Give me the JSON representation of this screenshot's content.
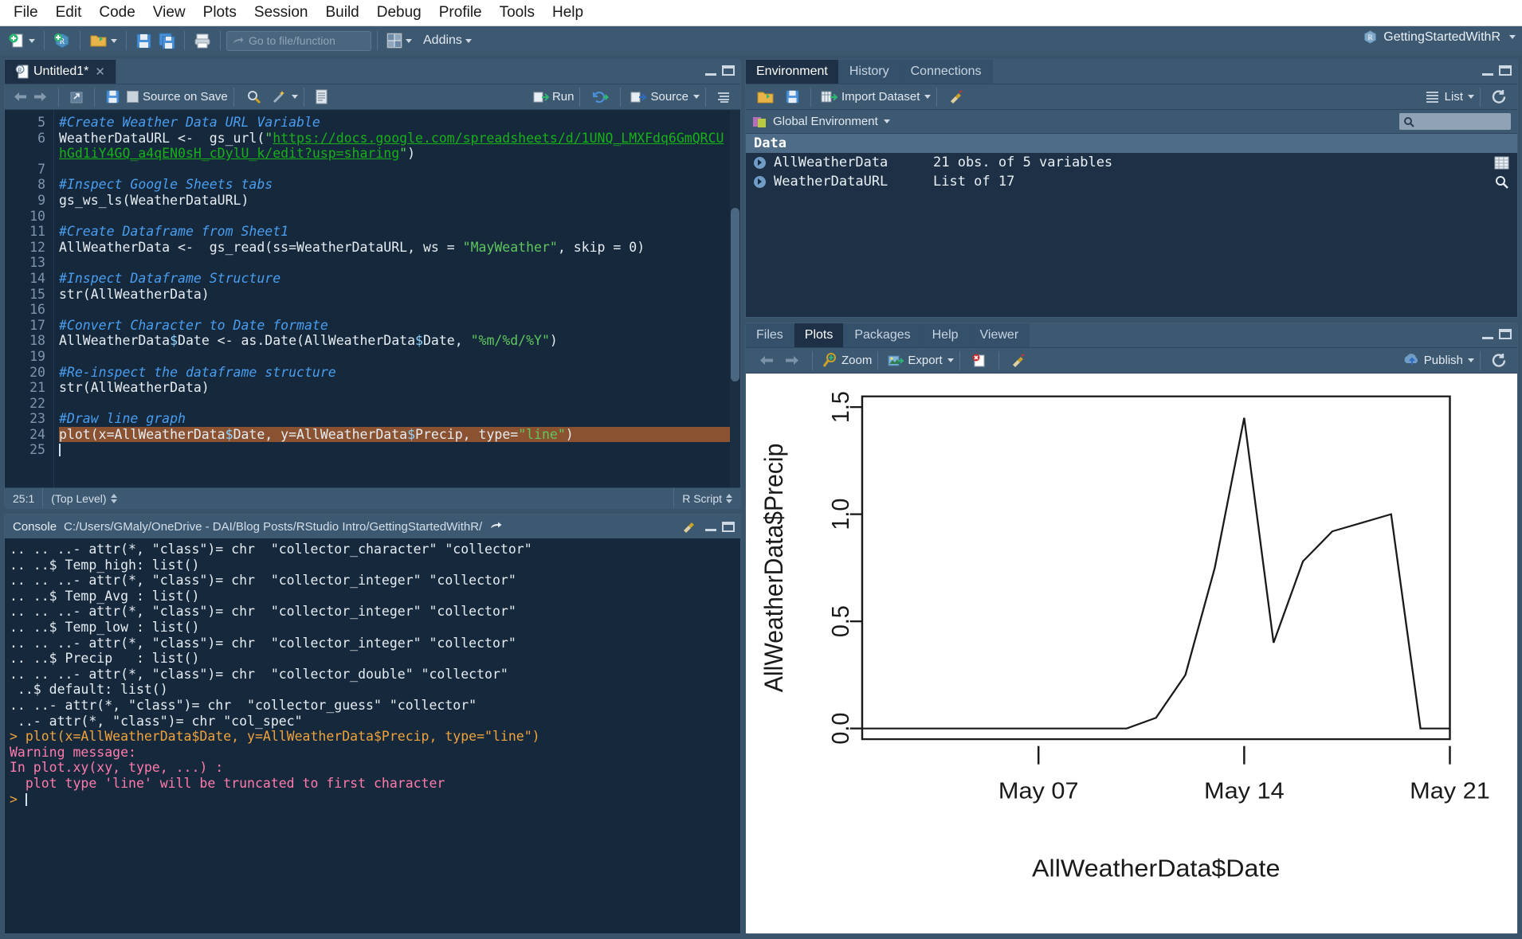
{
  "menubar": {
    "items": [
      "File",
      "Edit",
      "Code",
      "View",
      "Plots",
      "Session",
      "Build",
      "Debug",
      "Profile",
      "Tools",
      "Help"
    ]
  },
  "toolbar": {
    "goto_placeholder": "Go to file/function",
    "addins_label": "Addins",
    "project_name": "GettingStartedWithR",
    "icons": [
      "new-file-icon",
      "new-project-icon",
      "open-file-icon",
      "save-icon",
      "save-all-icon",
      "print-icon",
      "forward-arrow-icon",
      "panes-icon"
    ]
  },
  "source_pane": {
    "tab_label": "Untitled1*",
    "toolbar": {
      "back_label": "back-arrow-icon",
      "forward_label": "forward-arrow-icon",
      "popout_label": "show-in-new-window-icon",
      "save_label": "save-icon",
      "source_on_save_label": "Source on Save",
      "find_label": "find-icon",
      "wand_label": "code-tools-icon",
      "compile_label": "compile-report-icon",
      "run_label": "Run",
      "rerun_label": "re-run-icon",
      "source_label": "Source",
      "outline_label": "outline-icon"
    },
    "lines": [
      {
        "n": "5",
        "html": "<span class='cmt'>#Create Weather Data URL Variable</span>"
      },
      {
        "n": "6",
        "html": "WeatherDataURL &lt;-  gs_url(<span class='str'>\"</span><span class='url'>https://docs.google.com/spreadsheets/d/1UNQ_LMXFdq6GmQRCU</span>"
      },
      {
        "n": "",
        "html": "<span class='url'>hGd1iY4GQ_a4qEN0sH_cDylU_k/edit?usp=sharing</span><span class='str'>\"</span>)"
      },
      {
        "n": "7",
        "html": ""
      },
      {
        "n": "8",
        "html": "<span class='cmt'>#Inspect Google Sheets tabs</span>"
      },
      {
        "n": "9",
        "html": "gs_ws_ls(WeatherDataURL)"
      },
      {
        "n": "10",
        "html": ""
      },
      {
        "n": "11",
        "html": "<span class='cmt'>#Create Dataframe from Sheet1</span>"
      },
      {
        "n": "12",
        "html": "AllWeatherData &lt;-  gs_read(ss=WeatherDataURL, ws = <span class='str'>\"MayWeather\"</span>, skip = <span class='num'>0</span>)"
      },
      {
        "n": "13",
        "html": ""
      },
      {
        "n": "14",
        "html": "<span class='cmt'>#Inspect Dataframe Structure</span>"
      },
      {
        "n": "15",
        "html": "str(AllWeatherData)"
      },
      {
        "n": "16",
        "html": ""
      },
      {
        "n": "17",
        "html": "<span class='cmt'>#Convert Character to Date formate</span>"
      },
      {
        "n": "18",
        "html": "AllWeatherData<span class='dollar'>$</span>Date &lt;- as.Date(AllWeatherData<span class='dollar'>$</span>Date, <span class='str'>\"%m/%d/%Y\"</span>)"
      },
      {
        "n": "19",
        "html": ""
      },
      {
        "n": "20",
        "html": "<span class='cmt'>#Re-inspect the dataframe structure</span>"
      },
      {
        "n": "21",
        "html": "str(AllWeatherData)"
      },
      {
        "n": "22",
        "html": ""
      },
      {
        "n": "23",
        "html": "<span class='cmt'>#Draw line graph</span>"
      },
      {
        "n": "24",
        "html": "<span class='hl'>plot(x=AllWeatherData<span class='dollar'>$</span>Date, y=AllWeatherData<span class='dollar'>$</span>Precip, type=<span class='str'>\"line\"</span>)</span>"
      },
      {
        "n": "25",
        "html": "<span class='cursorbar'></span>"
      }
    ],
    "status": {
      "position": "25:1",
      "scope": "(Top Level)",
      "filetype": "R Script"
    }
  },
  "console_pane": {
    "title": "Console",
    "path": "C:/Users/GMaly/OneDrive - DAI/Blog Posts/RStudio Intro/GettingStartedWithR/",
    "lines": [
      {
        "cls": "c-out",
        "text": ".. .. ..- attr(*, \"class\")= chr  \"collector_character\" \"collector\""
      },
      {
        "cls": "c-out",
        "text": ".. ..$ Temp_high: list()"
      },
      {
        "cls": "c-out",
        "text": ".. .. ..- attr(*, \"class\")= chr  \"collector_integer\" \"collector\""
      },
      {
        "cls": "c-out",
        "text": ".. ..$ Temp_Avg : list()"
      },
      {
        "cls": "c-out",
        "text": ".. .. ..- attr(*, \"class\")= chr  \"collector_integer\" \"collector\""
      },
      {
        "cls": "c-out",
        "text": ".. ..$ Temp_low : list()"
      },
      {
        "cls": "c-out",
        "text": ".. .. ..- attr(*, \"class\")= chr  \"collector_integer\" \"collector\""
      },
      {
        "cls": "c-out",
        "text": ".. ..$ Precip   : list()"
      },
      {
        "cls": "c-out",
        "text": ".. .. ..- attr(*, \"class\")= chr  \"collector_double\" \"collector\""
      },
      {
        "cls": "c-out",
        "text": " ..$ default: list()"
      },
      {
        "cls": "c-out",
        "text": ".. ..- attr(*, \"class\")= chr  \"collector_guess\" \"collector\""
      },
      {
        "cls": "c-out",
        "text": " ..- attr(*, \"class\")= chr \"col_spec\""
      },
      {
        "cls": "c-cmd",
        "text": "> plot(x=AllWeatherData$Date, y=AllWeatherData$Precip, type=\"line\")"
      },
      {
        "cls": "c-err",
        "text": "Warning message:"
      },
      {
        "cls": "c-err",
        "text": "In plot.xy(xy, type, ...) :"
      },
      {
        "cls": "c-err",
        "text": "  plot type 'line' will be truncated to first character"
      },
      {
        "cls": "c-prompt",
        "text": "> "
      }
    ]
  },
  "environment_pane": {
    "tabs": [
      "Environment",
      "History",
      "Connections"
    ],
    "active_tab": "Environment",
    "toolbar": {
      "load_label": "load-workspace-icon",
      "save_label": "save-workspace-icon",
      "import_label": "Import Dataset",
      "broom_label": "clear-objects-icon",
      "view_mode_label": "List",
      "refresh_label": "refresh-icon"
    },
    "scope_label": "Global Environment",
    "search_placeholder": "",
    "section_header": "Data",
    "objects": [
      {
        "name": "AllWeatherData",
        "value": "21 obs. of 5 variables",
        "action": "view-table-icon"
      },
      {
        "name": "WeatherDataURL",
        "value": "List of 17",
        "action": "view-search-icon"
      }
    ]
  },
  "plots_pane": {
    "tabs": [
      "Files",
      "Plots",
      "Packages",
      "Help",
      "Viewer"
    ],
    "active_tab": "Plots",
    "toolbar": {
      "prev_label": "previous-plot-icon",
      "next_label": "next-plot-icon",
      "zoom_label": "Zoom",
      "export_label": "Export",
      "remove_label": "remove-plot-icon",
      "clear_label": "clear-plots-icon",
      "publish_label": "Publish",
      "refresh_label": "refresh-icon"
    }
  },
  "chart_data": {
    "type": "line",
    "title": "",
    "xlabel": "AllWeatherData$Date",
    "ylabel": "AllWeatherData$Precip",
    "xtick_labels": [
      "May 07",
      "May 14",
      "May 21"
    ],
    "xtick_values": [
      7,
      14,
      21
    ],
    "ytick_labels": [
      "0.0",
      "0.5",
      "1.0",
      "1.5"
    ],
    "ytick_values": [
      0.0,
      0.5,
      1.0,
      1.5
    ],
    "ylim": [
      -0.05,
      1.55
    ],
    "xlim": [
      1,
      21
    ],
    "grid": false,
    "legend": "none",
    "x": [
      1,
      2,
      3,
      4,
      5,
      6,
      7,
      8,
      9,
      10,
      11,
      12,
      13,
      14,
      15,
      16,
      17,
      18,
      19,
      20,
      21
    ],
    "values": [
      0.0,
      0.0,
      0.0,
      0.0,
      0.0,
      0.0,
      0.0,
      0.0,
      0.0,
      0.0,
      0.05,
      0.25,
      0.75,
      1.45,
      0.4,
      0.78,
      0.92,
      0.96,
      1.0,
      0.0,
      0.0
    ]
  }
}
